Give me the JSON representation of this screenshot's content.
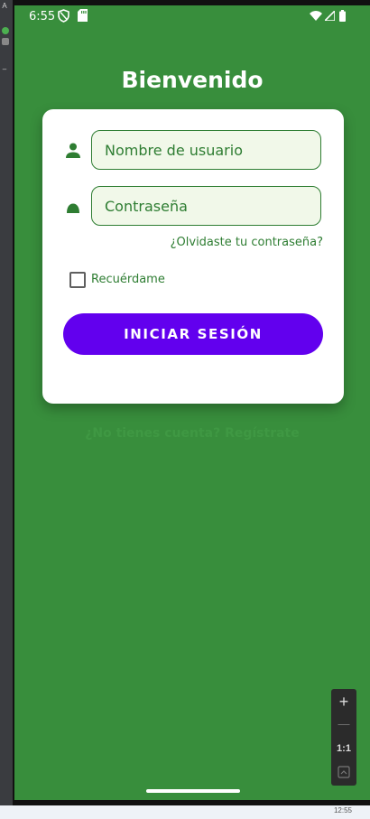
{
  "statusbar": {
    "time": "6:55",
    "icons": [
      "shield-icon",
      "sd-card-icon",
      "wifi-icon",
      "signal-icon",
      "battery-icon"
    ]
  },
  "login": {
    "title": "Bienvenido",
    "username_placeholder": "Nombre de usuario",
    "password_placeholder": "Contraseña",
    "forgot_label": "¿Olvidaste tu contraseña?",
    "remember_label": "Recuérdame",
    "remember_checked": false,
    "login_button": "INICIAR SESIÓN",
    "signup_label": "¿No tienes cuenta? Regístrate"
  },
  "zoom_controls": {
    "zoom_in": "+",
    "zoom_out": "—",
    "reset": "1:1"
  },
  "host": {
    "clock": "12:55"
  },
  "colors": {
    "background": "#388e3c",
    "accent_green": "#2e7d32",
    "field_fill": "#f1f8e9",
    "button": "#6200ee",
    "card": "#ffffff"
  }
}
